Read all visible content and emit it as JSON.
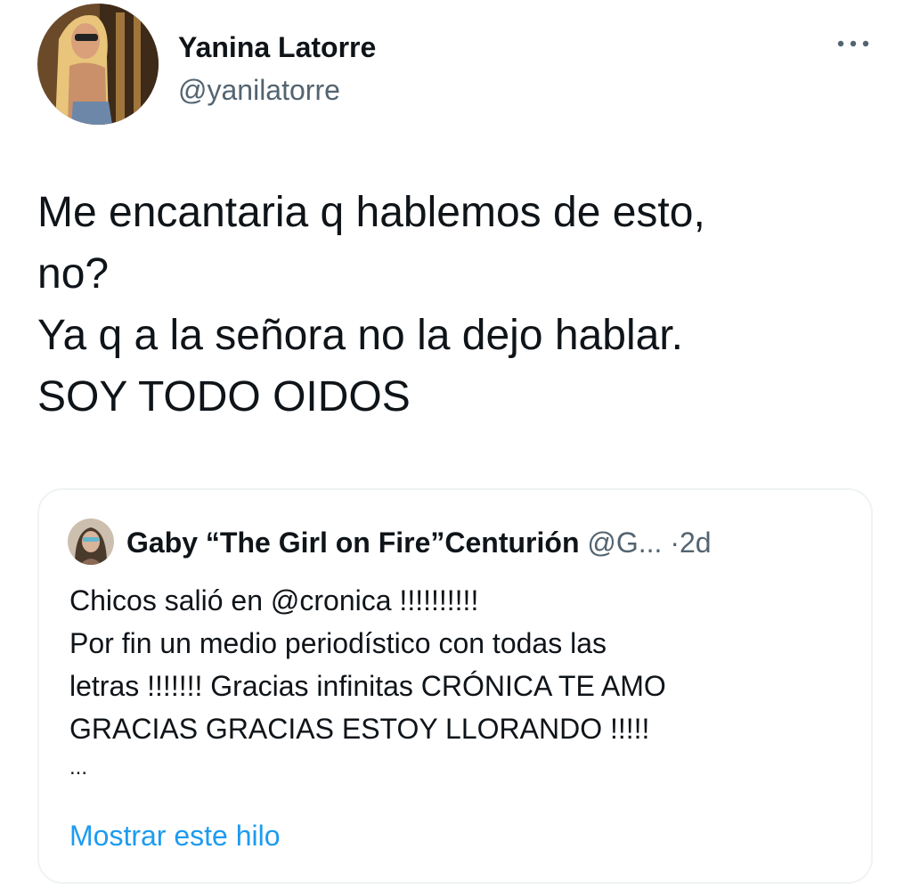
{
  "tweet": {
    "author": {
      "name": "Yanina Latorre",
      "handle": "@yanilatorre"
    },
    "more_icon": "more-horizontal-icon",
    "text_lines": [
      "Me encantaria q hablemos de esto,",
      "no?",
      "Ya q a la señora no la dejo hablar.",
      "SOY TODO OIDOS"
    ]
  },
  "quoted_tweet": {
    "author_name": "Gaby “The Girl on Fire”Centurión",
    "handle": "@G...",
    "separator": "·",
    "time": "2d",
    "text_lines": [
      "Chicos salió en @cronica !!!!!!!!!!",
      "Por fin un medio periodístico con todas las",
      "letras !!!!!!! Gracias infinitas CRÓNICA TE AMO",
      "GRACIAS GRACIAS ESTOY LLORANDO !!!!!",
      "..."
    ],
    "show_thread_label": "Mostrar este hilo"
  },
  "colors": {
    "text_primary": "#0f1419",
    "text_secondary": "#536471",
    "link": "#1d9bf0",
    "border": "#eff3f4"
  }
}
